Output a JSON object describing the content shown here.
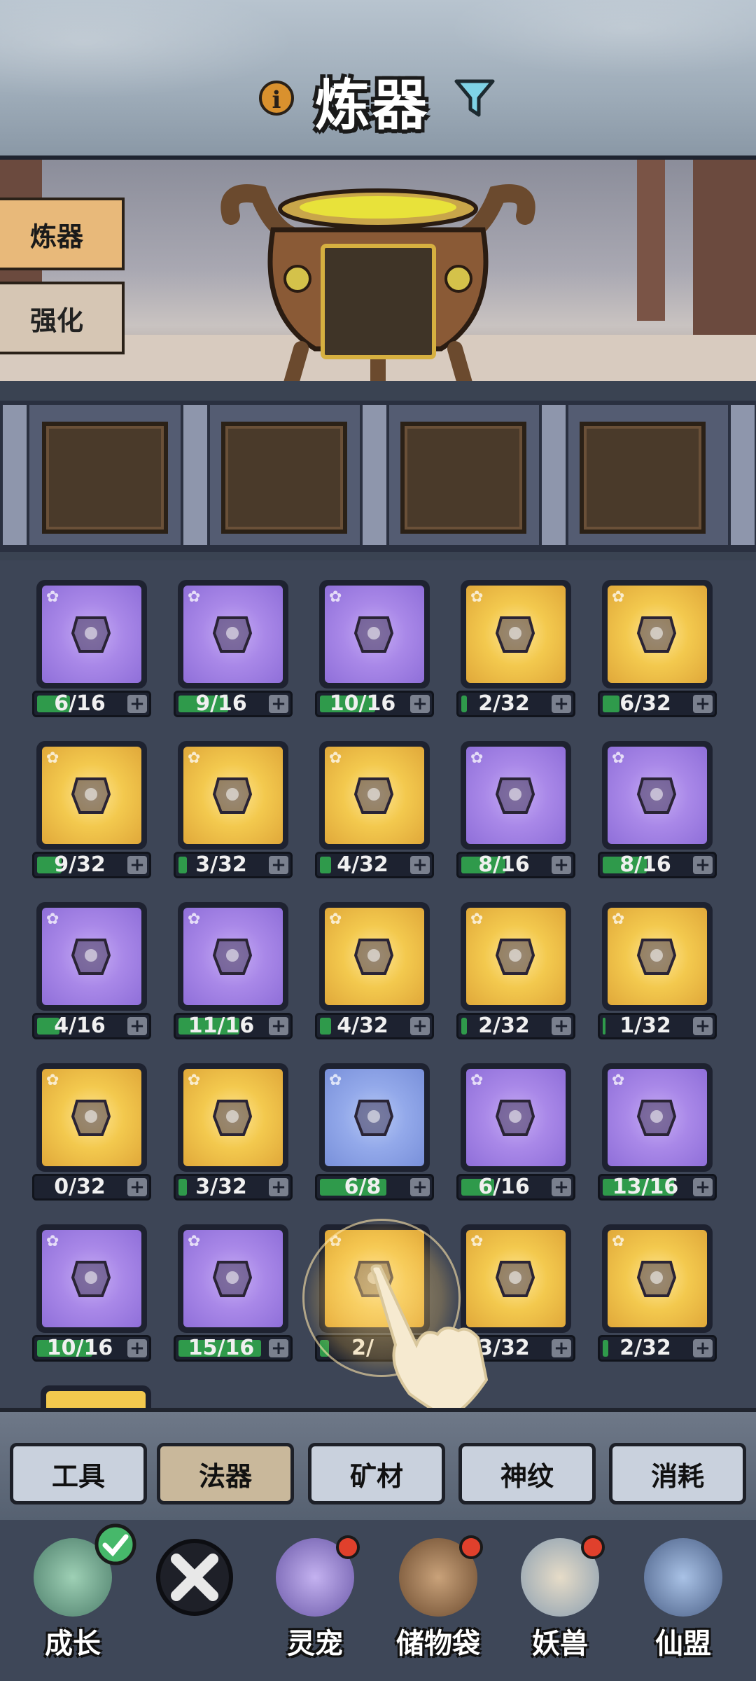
{
  "header": {
    "title": "炼器",
    "info_icon": "info-icon",
    "filter_icon": "filter-icon"
  },
  "side_tabs": [
    {
      "label": "炼器",
      "active": true
    },
    {
      "label": "强化",
      "active": false
    }
  ],
  "items": [
    {
      "color": "purple",
      "progress": "6/16"
    },
    {
      "color": "purple",
      "progress": "9/16"
    },
    {
      "color": "purple",
      "progress": "10/16"
    },
    {
      "color": "gold",
      "progress": "2/32"
    },
    {
      "color": "gold",
      "progress": "6/32"
    },
    {
      "color": "gold",
      "progress": "9/32"
    },
    {
      "color": "gold",
      "progress": "3/32"
    },
    {
      "color": "gold",
      "progress": "4/32"
    },
    {
      "color": "purple",
      "progress": "8/16"
    },
    {
      "color": "purple",
      "progress": "8/16"
    },
    {
      "color": "purple",
      "progress": "4/16"
    },
    {
      "color": "purple",
      "progress": "11/16"
    },
    {
      "color": "gold",
      "progress": "4/32"
    },
    {
      "color": "gold",
      "progress": "2/32"
    },
    {
      "color": "gold",
      "progress": "1/32"
    },
    {
      "color": "gold",
      "progress": "0/32"
    },
    {
      "color": "gold",
      "progress": "3/32"
    },
    {
      "color": "blue",
      "progress": "6/8"
    },
    {
      "color": "purple",
      "progress": "6/16"
    },
    {
      "color": "purple",
      "progress": "13/16"
    },
    {
      "color": "purple",
      "progress": "10/16"
    },
    {
      "color": "purple",
      "progress": "15/16"
    },
    {
      "color": "gold",
      "progress": "2/"
    },
    {
      "color": "gold",
      "progress": "3/32"
    },
    {
      "color": "gold",
      "progress": "2/32"
    }
  ],
  "categories": [
    {
      "label": "工具",
      "active": false
    },
    {
      "label": "法器",
      "active": true
    },
    {
      "label": "矿材",
      "active": false
    },
    {
      "label": "神纹",
      "active": false
    },
    {
      "label": "消耗",
      "active": false
    }
  ],
  "nav": [
    {
      "label": "成长",
      "icon": "growth-icon",
      "badge": "check"
    },
    {
      "label": "",
      "icon": "close-icon",
      "badge": ""
    },
    {
      "label": "灵宠",
      "icon": "spirit-pet-icon",
      "badge": "dot"
    },
    {
      "label": "储物袋",
      "icon": "storage-bag-icon",
      "badge": "dot"
    },
    {
      "label": "妖兽",
      "icon": "demon-beast-icon",
      "badge": "dot"
    },
    {
      "label": "仙盟",
      "icon": "immortal-alliance-icon",
      "badge": ""
    }
  ],
  "colors": {
    "purple": "#a988e8",
    "gold": "#f3c94e",
    "blue": "#93a9ea",
    "progress_fill": "#2f9a4b"
  }
}
